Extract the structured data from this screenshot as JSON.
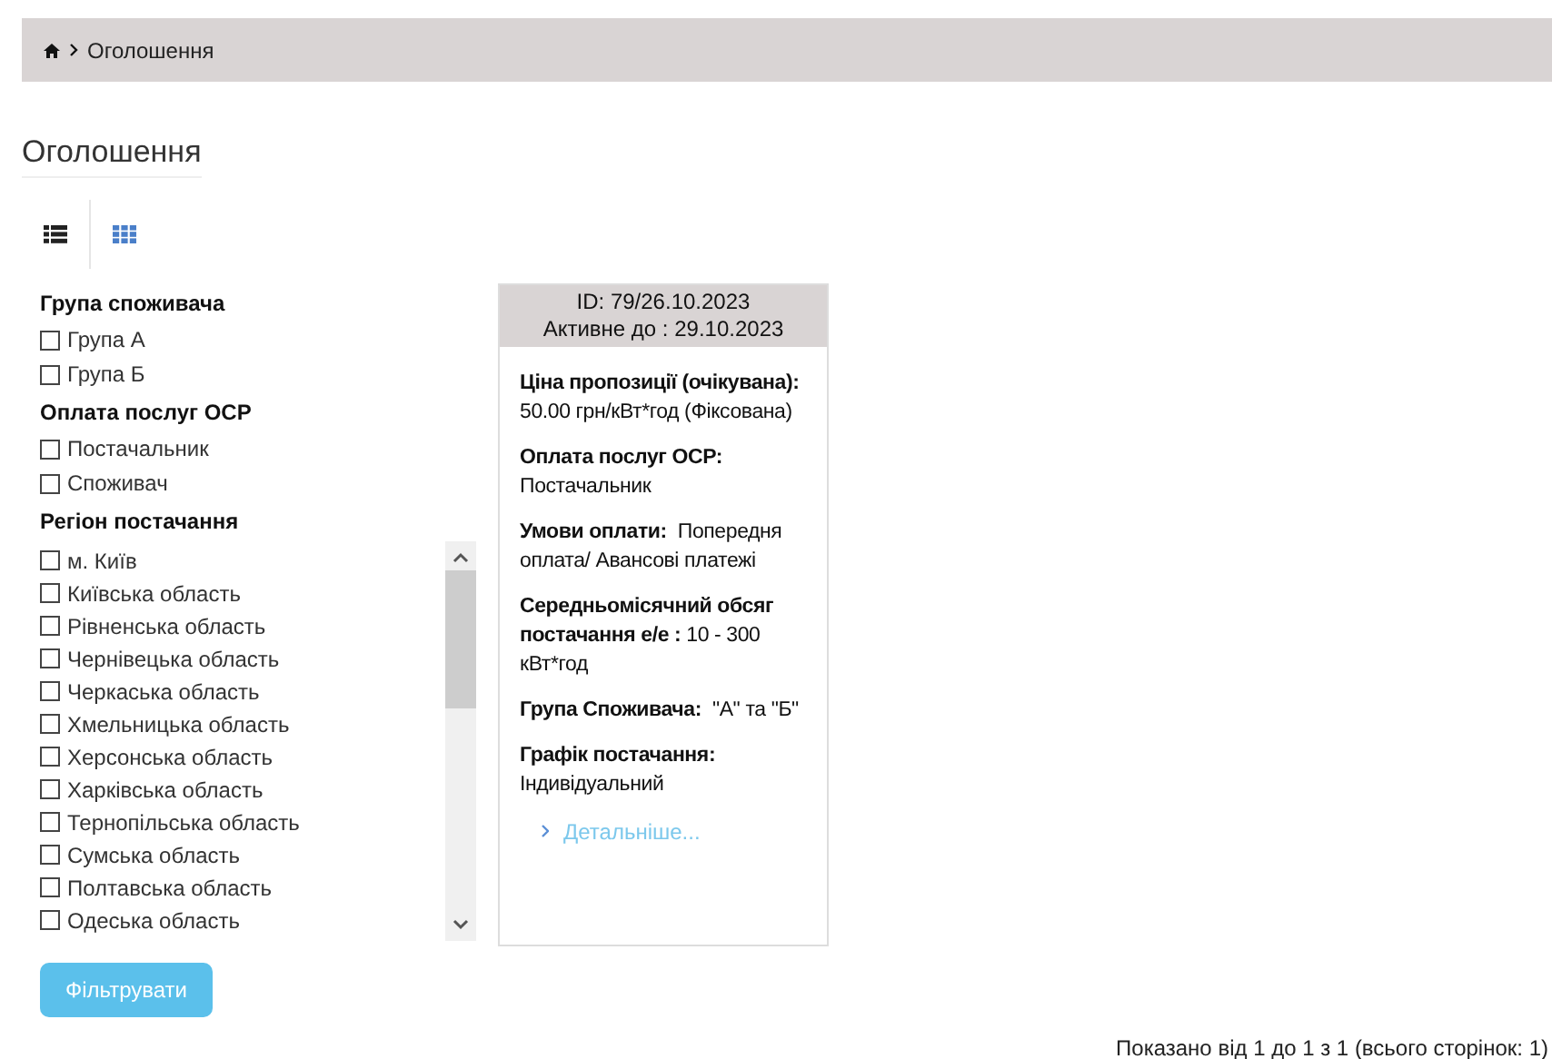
{
  "breadcrumb": {
    "current": "Оголошення"
  },
  "title": "Оголошення",
  "views": [
    {
      "kind": "list",
      "selected": true
    },
    {
      "kind": "grid",
      "selected": false
    }
  ],
  "filters": [
    {
      "heading": "Група споживача",
      "scroll": false,
      "options": [
        {
          "label": "Група А",
          "checked": false
        },
        {
          "label": "Група Б",
          "checked": false
        }
      ]
    },
    {
      "heading": "Оплата послуг ОСР",
      "scroll": false,
      "options": [
        {
          "label": "Постачальник",
          "checked": false
        },
        {
          "label": "Споживач",
          "checked": false
        }
      ]
    },
    {
      "heading": "Регіон постачання",
      "scroll": true,
      "options": [
        {
          "label": "м. Київ",
          "checked": false
        },
        {
          "label": "Київська область",
          "checked": false
        },
        {
          "label": "Рівненська область",
          "checked": false
        },
        {
          "label": "Чернівецька область",
          "checked": false
        },
        {
          "label": "Черкаська область",
          "checked": false
        },
        {
          "label": "Хмельницька область",
          "checked": false
        },
        {
          "label": "Херсонська область",
          "checked": false
        },
        {
          "label": "Харківська область",
          "checked": false
        },
        {
          "label": "Тернопільська область",
          "checked": false
        },
        {
          "label": "Сумська область",
          "checked": false
        },
        {
          "label": "Полтавська область",
          "checked": false
        },
        {
          "label": "Одеська область",
          "checked": false
        }
      ]
    }
  ],
  "filter_button": "Фільтрувати",
  "cards": [
    {
      "id": "ID: 79/26.10.2023",
      "active_until": "Активне до : 29.10.2023",
      "fields": [
        "**Ціна пропозиції (очікувана):** 50.00 грн/кВт*год (Фіксована)",
        "**Оплата послуг ОСР:** Постачальник",
        "**Умови оплати:**  Попередня оплата/ Авансові платежі",
        "**Середньомісячний обсяг постачання е/е :** 10 - 300 кВт*год",
        "**Група Споживача:**  \"А\" та \"Б\"",
        "**Графік постачання:** Індивідуальний"
      ],
      "link": "Детальніше..."
    }
  ],
  "pagination_info": "Показано від 1 до 1 з 1 (всього сторінок: 1)"
}
